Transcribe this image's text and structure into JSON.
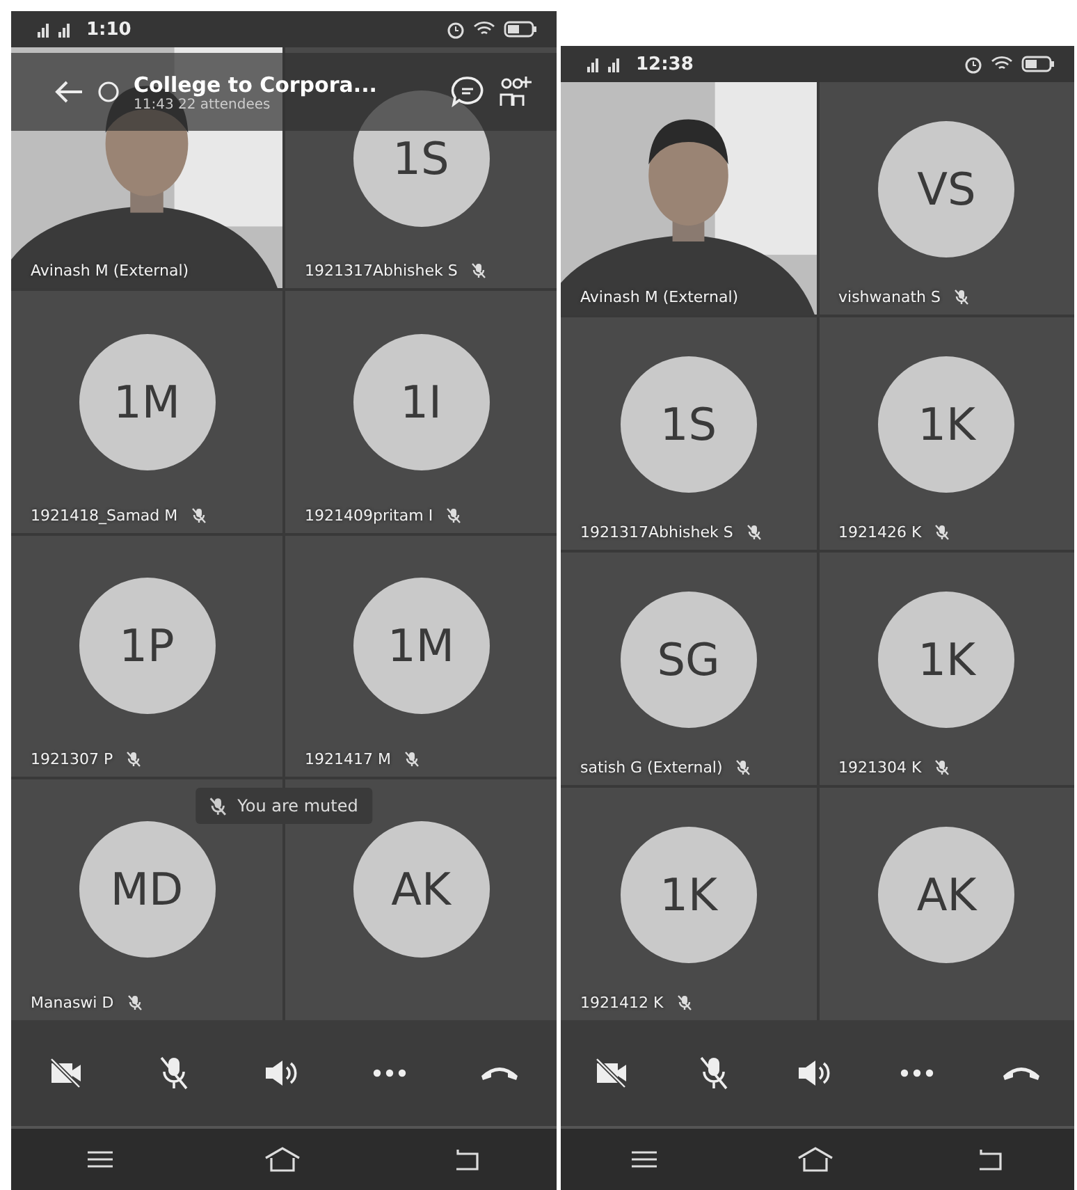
{
  "phones": [
    {
      "status_bar": {
        "time": "1:10"
      },
      "header": {
        "title": "College to Corpora...",
        "subtitle": "11:43  22 attendees"
      },
      "tiles": [
        {
          "kind": "video",
          "name": "Avinash M (External)",
          "muted": false
        },
        {
          "kind": "avatar",
          "initials": "1S",
          "name": "1921317Abhishek S",
          "muted": true
        },
        {
          "kind": "avatar",
          "initials": "1M",
          "name": "1921418_Samad M",
          "muted": true
        },
        {
          "kind": "avatar",
          "initials": "1I",
          "name": "1921409pritam I",
          "muted": true
        },
        {
          "kind": "avatar",
          "initials": "1P",
          "name": "1921307 P",
          "muted": true
        },
        {
          "kind": "avatar",
          "initials": "1M",
          "name": "1921417 M",
          "muted": true
        },
        {
          "kind": "avatar",
          "initials": "MD",
          "name": "Manaswi D",
          "muted": true
        },
        {
          "kind": "avatar",
          "initials": "AK"
        }
      ],
      "toast": {
        "text": "You are muted"
      },
      "controls": [
        {
          "kind": "camera-off"
        },
        {
          "kind": "mic-off"
        },
        {
          "kind": "speaker"
        },
        {
          "kind": "more"
        },
        {
          "kind": "hang-up"
        }
      ]
    },
    {
      "status_bar": {
        "time": "12:38"
      },
      "tiles": [
        {
          "kind": "video",
          "name": "Avinash M (External)",
          "muted": false
        },
        {
          "kind": "avatar",
          "initials": "VS",
          "name": "vishwanath S",
          "muted": true
        },
        {
          "kind": "avatar",
          "initials": "1S",
          "name": "1921317Abhishek S",
          "muted": true
        },
        {
          "kind": "avatar",
          "initials": "1K",
          "name": "1921426 K",
          "muted": true
        },
        {
          "kind": "avatar",
          "initials": "SG",
          "name": "satish G (External)",
          "muted": true
        },
        {
          "kind": "avatar",
          "initials": "1K",
          "name": "1921304 K",
          "muted": true
        },
        {
          "kind": "avatar",
          "initials": "1K",
          "name": "1921412 K",
          "muted": true
        },
        {
          "kind": "avatar",
          "initials": "AK"
        }
      ],
      "controls": [
        {
          "kind": "camera-off"
        },
        {
          "kind": "mic-off"
        },
        {
          "kind": "speaker"
        },
        {
          "kind": "more"
        },
        {
          "kind": "hang-up"
        }
      ]
    }
  ]
}
